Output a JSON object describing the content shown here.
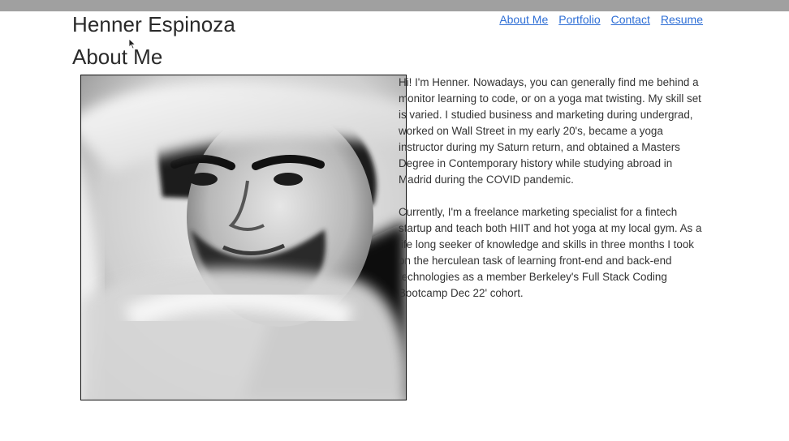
{
  "header": {
    "site_name": "Henner Espinoza"
  },
  "nav": {
    "items": [
      {
        "label": "About Me"
      },
      {
        "label": "Portfolio"
      },
      {
        "label": "Contact"
      },
      {
        "label": "Resume"
      }
    ]
  },
  "about": {
    "title": "About Me",
    "paragraphs": [
      "Hi! I'm Henner. Nowadays, you can generally find me behind a monitor learning to code, or on a yoga mat twisting. My skill set is varied. I studied business and marketing during undergrad, worked on Wall Street in my early 20's, became a yoga instructor during my Saturn return, and obtained a Masters Degree in Contemporary history while studying abroad in Madrid during the COVID pandemic.",
      "Currently, I'm a freelance marketing specialist for a fintech startup and teach both HIIT and hot yoga at my local gym. As a life long seeker of knowledge and skills in three months I took on the herculean task of learning front-end and back-end technologies as a member Berkeley's Full Stack Coding Bootcamp Dec 22' cohort."
    ]
  },
  "colors": {
    "link": "#2f6fd6",
    "text": "#333333",
    "topbar": "#a0a0a0"
  }
}
